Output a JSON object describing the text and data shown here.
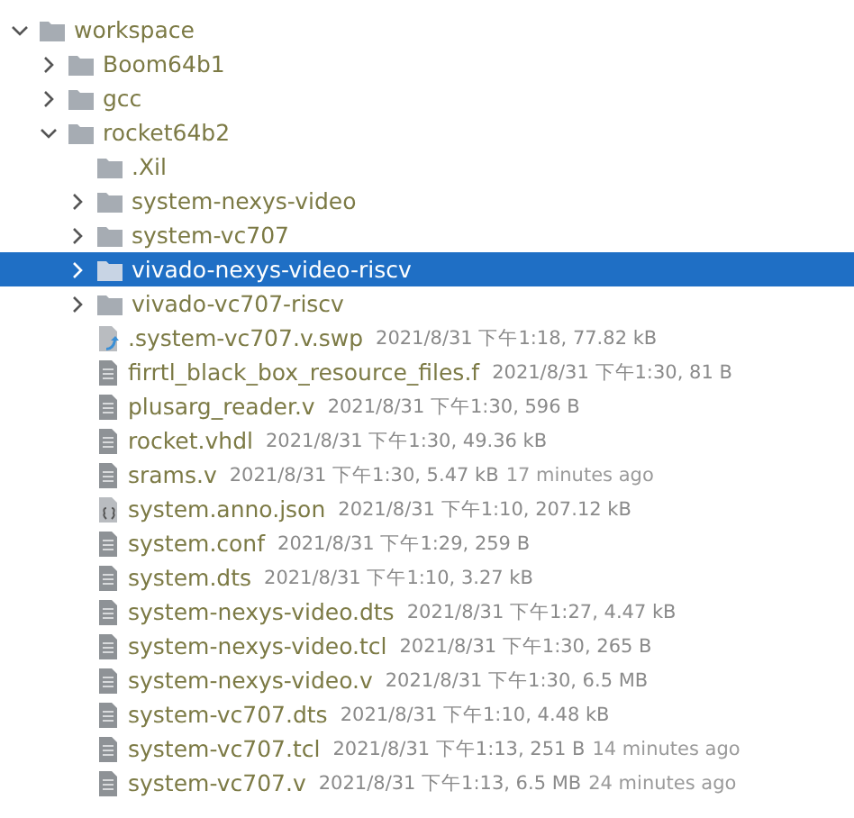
{
  "tree": [
    {
      "name": "workspace",
      "kind": "folder",
      "expanded": true,
      "selected": false,
      "children": [
        {
          "name": "Boom64b1",
          "kind": "folder",
          "expanded": false,
          "selected": false
        },
        {
          "name": "gcc",
          "kind": "folder",
          "expanded": false,
          "selected": false
        },
        {
          "name": "rocket64b2",
          "kind": "folder",
          "expanded": true,
          "selected": false,
          "children": [
            {
              "name": ".Xil",
              "kind": "empty-folder",
              "selected": false
            },
            {
              "name": "system-nexys-video",
              "kind": "folder",
              "expanded": false,
              "selected": false
            },
            {
              "name": "system-vc707",
              "kind": "folder",
              "expanded": false,
              "selected": false
            },
            {
              "name": "vivado-nexys-video-riscv",
              "kind": "folder",
              "expanded": false,
              "selected": true
            },
            {
              "name": "vivado-vc707-riscv",
              "kind": "folder",
              "expanded": false,
              "selected": false
            },
            {
              "name": ".system-vc707.v.swp",
              "kind": "swap-file",
              "selected": false,
              "details": "2021/8/31 下午1:18, 77.82 kB"
            },
            {
              "name": "firrtl_black_box_resource_files.f",
              "kind": "file",
              "selected": false,
              "details": "2021/8/31 下午1:30, 81 B"
            },
            {
              "name": "plusarg_reader.v",
              "kind": "file",
              "selected": false,
              "details": "2021/8/31 下午1:30, 596 B"
            },
            {
              "name": "rocket.vhdl",
              "kind": "file",
              "selected": false,
              "details": "2021/8/31 下午1:30, 49.36 kB"
            },
            {
              "name": "srams.v",
              "kind": "file",
              "selected": false,
              "details": "2021/8/31 下午1:30, 5.47 kB",
              "ago": "17 minutes ago"
            },
            {
              "name": "system.anno.json",
              "kind": "json-file",
              "selected": false,
              "details": "2021/8/31 下午1:10, 207.12 kB"
            },
            {
              "name": "system.conf",
              "kind": "file",
              "selected": false,
              "details": "2021/8/31 下午1:29, 259 B"
            },
            {
              "name": "system.dts",
              "kind": "file",
              "selected": false,
              "details": "2021/8/31 下午1:10, 3.27 kB"
            },
            {
              "name": "system-nexys-video.dts",
              "kind": "file",
              "selected": false,
              "details": "2021/8/31 下午1:27, 4.47 kB"
            },
            {
              "name": "system-nexys-video.tcl",
              "kind": "file",
              "selected": false,
              "details": "2021/8/31 下午1:30, 265 B"
            },
            {
              "name": "system-nexys-video.v",
              "kind": "file",
              "selected": false,
              "details": "2021/8/31 下午1:30, 6.5 MB"
            },
            {
              "name": "system-vc707.dts",
              "kind": "file",
              "selected": false,
              "details": "2021/8/31 下午1:10, 4.48 kB"
            },
            {
              "name": "system-vc707.tcl",
              "kind": "file",
              "selected": false,
              "details": "2021/8/31 下午1:13, 251 B",
              "ago": "14 minutes ago"
            },
            {
              "name": "system-vc707.v",
              "kind": "file",
              "selected": false,
              "details": "2021/8/31 下午1:13, 6.5 MB",
              "ago": "24 minutes ago"
            }
          ]
        }
      ]
    }
  ]
}
